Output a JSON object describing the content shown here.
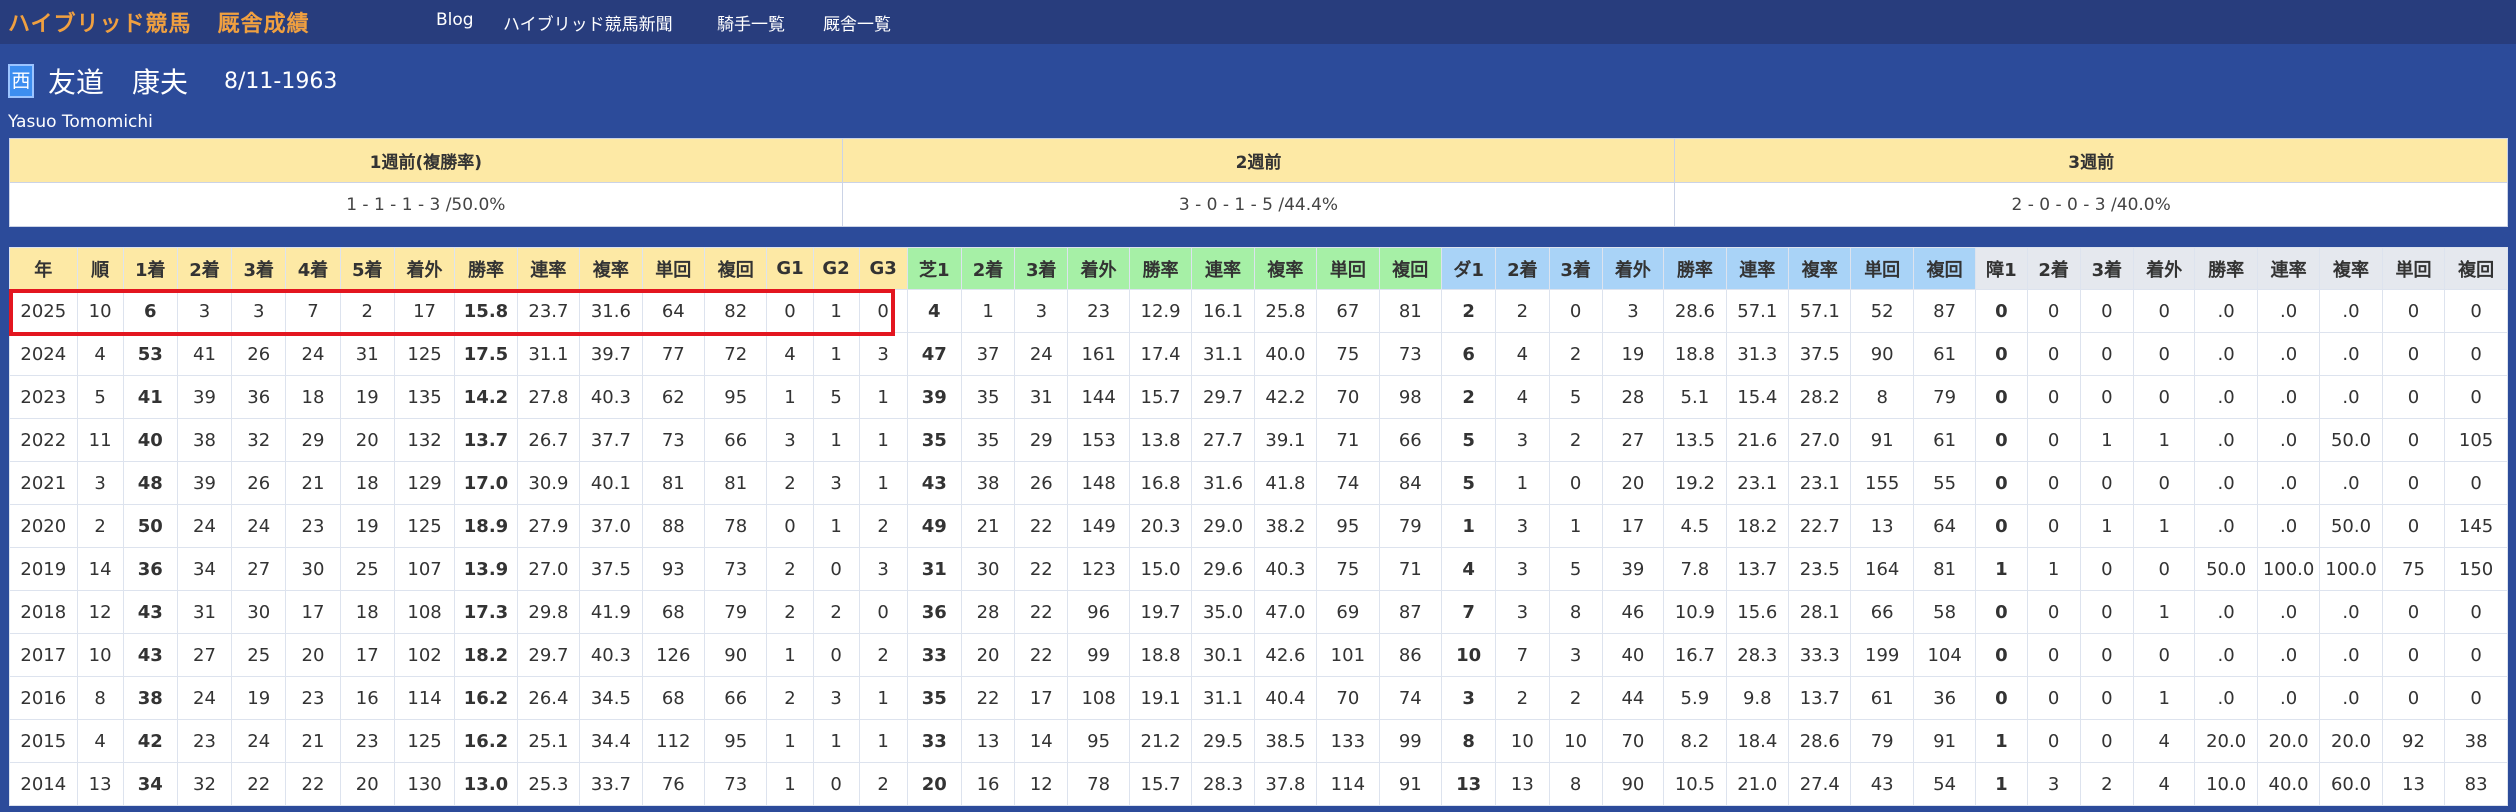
{
  "nav": {
    "brand": "ハイブリッド競馬",
    "brand_sub": "厩舎成績",
    "links": [
      "Blog",
      "ハイブリッド競馬新聞",
      "騎手一覧",
      "厩舎一覧"
    ]
  },
  "trainer": {
    "region": "西",
    "name": "友道　康夫",
    "dob": "8/11-1963",
    "roman": "Yasuo Tomomichi"
  },
  "weekly": {
    "headers": [
      "1週前(複勝率)",
      "2週前",
      "3週前"
    ],
    "values": [
      "1 - 1 - 1 - 3 /50.0%",
      "3 - 0 - 1 - 5 /44.4%",
      "2 - 0 - 0 - 3 /40.0%"
    ]
  },
  "stats": {
    "headers": [
      "年",
      "順",
      "1着",
      "2着",
      "3着",
      "4着",
      "5着",
      "着外",
      "勝率",
      "連率",
      "複率",
      "単回",
      "複回",
      "G1",
      "G2",
      "G3",
      "芝1",
      "2着",
      "3着",
      "着外",
      "勝率",
      "連率",
      "複率",
      "単回",
      "複回",
      "ダ1",
      "2着",
      "3着",
      "着外",
      "勝率",
      "連率",
      "複率",
      "単回",
      "複回",
      "障1",
      "2着",
      "3着",
      "着外",
      "勝率",
      "連率",
      "複率",
      "単回",
      "複回"
    ],
    "rows": [
      [
        "2025",
        "10",
        "6",
        "3",
        "3",
        "7",
        "2",
        "17",
        "15.8",
        "23.7",
        "31.6",
        "64",
        "82",
        "0",
        "1",
        "0",
        "4",
        "1",
        "3",
        "23",
        "12.9",
        "16.1",
        "25.8",
        "67",
        "81",
        "2",
        "2",
        "0",
        "3",
        "28.6",
        "57.1",
        "57.1",
        "52",
        "87",
        "0",
        "0",
        "0",
        "0",
        ".0",
        ".0",
        ".0",
        "0",
        "0"
      ],
      [
        "2024",
        "4",
        "53",
        "41",
        "26",
        "24",
        "31",
        "125",
        "17.5",
        "31.1",
        "39.7",
        "77",
        "72",
        "4",
        "1",
        "3",
        "47",
        "37",
        "24",
        "161",
        "17.4",
        "31.1",
        "40.0",
        "75",
        "73",
        "6",
        "4",
        "2",
        "19",
        "18.8",
        "31.3",
        "37.5",
        "90",
        "61",
        "0",
        "0",
        "0",
        "0",
        ".0",
        ".0",
        ".0",
        "0",
        "0"
      ],
      [
        "2023",
        "5",
        "41",
        "39",
        "36",
        "18",
        "19",
        "135",
        "14.2",
        "27.8",
        "40.3",
        "62",
        "95",
        "1",
        "5",
        "1",
        "39",
        "35",
        "31",
        "144",
        "15.7",
        "29.7",
        "42.2",
        "70",
        "98",
        "2",
        "4",
        "5",
        "28",
        "5.1",
        "15.4",
        "28.2",
        "8",
        "79",
        "0",
        "0",
        "0",
        "0",
        ".0",
        ".0",
        ".0",
        "0",
        "0"
      ],
      [
        "2022",
        "11",
        "40",
        "38",
        "32",
        "29",
        "20",
        "132",
        "13.7",
        "26.7",
        "37.7",
        "73",
        "66",
        "3",
        "1",
        "1",
        "35",
        "35",
        "29",
        "153",
        "13.8",
        "27.7",
        "39.1",
        "71",
        "66",
        "5",
        "3",
        "2",
        "27",
        "13.5",
        "21.6",
        "27.0",
        "91",
        "61",
        "0",
        "0",
        "1",
        "1",
        ".0",
        ".0",
        "50.0",
        "0",
        "105"
      ],
      [
        "2021",
        "3",
        "48",
        "39",
        "26",
        "21",
        "18",
        "129",
        "17.0",
        "30.9",
        "40.1",
        "81",
        "81",
        "2",
        "3",
        "1",
        "43",
        "38",
        "26",
        "148",
        "16.8",
        "31.6",
        "41.8",
        "74",
        "84",
        "5",
        "1",
        "0",
        "20",
        "19.2",
        "23.1",
        "23.1",
        "155",
        "55",
        "0",
        "0",
        "0",
        "0",
        ".0",
        ".0",
        ".0",
        "0",
        "0"
      ],
      [
        "2020",
        "2",
        "50",
        "24",
        "24",
        "23",
        "19",
        "125",
        "18.9",
        "27.9",
        "37.0",
        "88",
        "78",
        "0",
        "1",
        "2",
        "49",
        "21",
        "22",
        "149",
        "20.3",
        "29.0",
        "38.2",
        "95",
        "79",
        "1",
        "3",
        "1",
        "17",
        "4.5",
        "18.2",
        "22.7",
        "13",
        "64",
        "0",
        "0",
        "1",
        "1",
        ".0",
        ".0",
        "50.0",
        "0",
        "145"
      ],
      [
        "2019",
        "14",
        "36",
        "34",
        "27",
        "30",
        "25",
        "107",
        "13.9",
        "27.0",
        "37.5",
        "93",
        "73",
        "2",
        "0",
        "3",
        "31",
        "30",
        "22",
        "123",
        "15.0",
        "29.6",
        "40.3",
        "75",
        "71",
        "4",
        "3",
        "5",
        "39",
        "7.8",
        "13.7",
        "23.5",
        "164",
        "81",
        "1",
        "1",
        "0",
        "0",
        "50.0",
        "100.0",
        "100.0",
        "75",
        "150"
      ],
      [
        "2018",
        "12",
        "43",
        "31",
        "30",
        "17",
        "18",
        "108",
        "17.3",
        "29.8",
        "41.9",
        "68",
        "79",
        "2",
        "2",
        "0",
        "36",
        "28",
        "22",
        "96",
        "19.7",
        "35.0",
        "47.0",
        "69",
        "87",
        "7",
        "3",
        "8",
        "46",
        "10.9",
        "15.6",
        "28.1",
        "66",
        "58",
        "0",
        "0",
        "0",
        "1",
        ".0",
        ".0",
        ".0",
        "0",
        "0"
      ],
      [
        "2017",
        "10",
        "43",
        "27",
        "25",
        "20",
        "17",
        "102",
        "18.2",
        "29.7",
        "40.3",
        "126",
        "90",
        "1",
        "0",
        "2",
        "33",
        "20",
        "22",
        "99",
        "18.8",
        "30.1",
        "42.6",
        "101",
        "86",
        "10",
        "7",
        "3",
        "40",
        "16.7",
        "28.3",
        "33.3",
        "199",
        "104",
        "0",
        "0",
        "0",
        "0",
        ".0",
        ".0",
        ".0",
        "0",
        "0"
      ],
      [
        "2016",
        "8",
        "38",
        "24",
        "19",
        "23",
        "16",
        "114",
        "16.2",
        "26.4",
        "34.5",
        "68",
        "66",
        "2",
        "3",
        "1",
        "35",
        "22",
        "17",
        "108",
        "19.1",
        "31.1",
        "40.4",
        "70",
        "74",
        "3",
        "2",
        "2",
        "44",
        "5.9",
        "9.8",
        "13.7",
        "61",
        "36",
        "0",
        "0",
        "0",
        "1",
        ".0",
        ".0",
        ".0",
        "0",
        "0"
      ],
      [
        "2015",
        "4",
        "42",
        "23",
        "24",
        "21",
        "23",
        "125",
        "16.2",
        "25.1",
        "34.4",
        "112",
        "95",
        "1",
        "1",
        "1",
        "33",
        "13",
        "14",
        "95",
        "21.2",
        "29.5",
        "38.5",
        "133",
        "99",
        "8",
        "10",
        "10",
        "70",
        "8.2",
        "18.4",
        "28.6",
        "79",
        "91",
        "1",
        "0",
        "0",
        "4",
        "20.0",
        "20.0",
        "20.0",
        "92",
        "38"
      ],
      [
        "2014",
        "13",
        "34",
        "32",
        "22",
        "22",
        "20",
        "130",
        "13.0",
        "25.3",
        "33.7",
        "76",
        "73",
        "1",
        "0",
        "2",
        "20",
        "16",
        "12",
        "78",
        "15.7",
        "28.3",
        "37.8",
        "114",
        "91",
        "13",
        "13",
        "8",
        "90",
        "10.5",
        "21.0",
        "27.4",
        "43",
        "54",
        "1",
        "3",
        "2",
        "4",
        "10.0",
        "40.0",
        "60.0",
        "13",
        "83"
      ]
    ]
  }
}
